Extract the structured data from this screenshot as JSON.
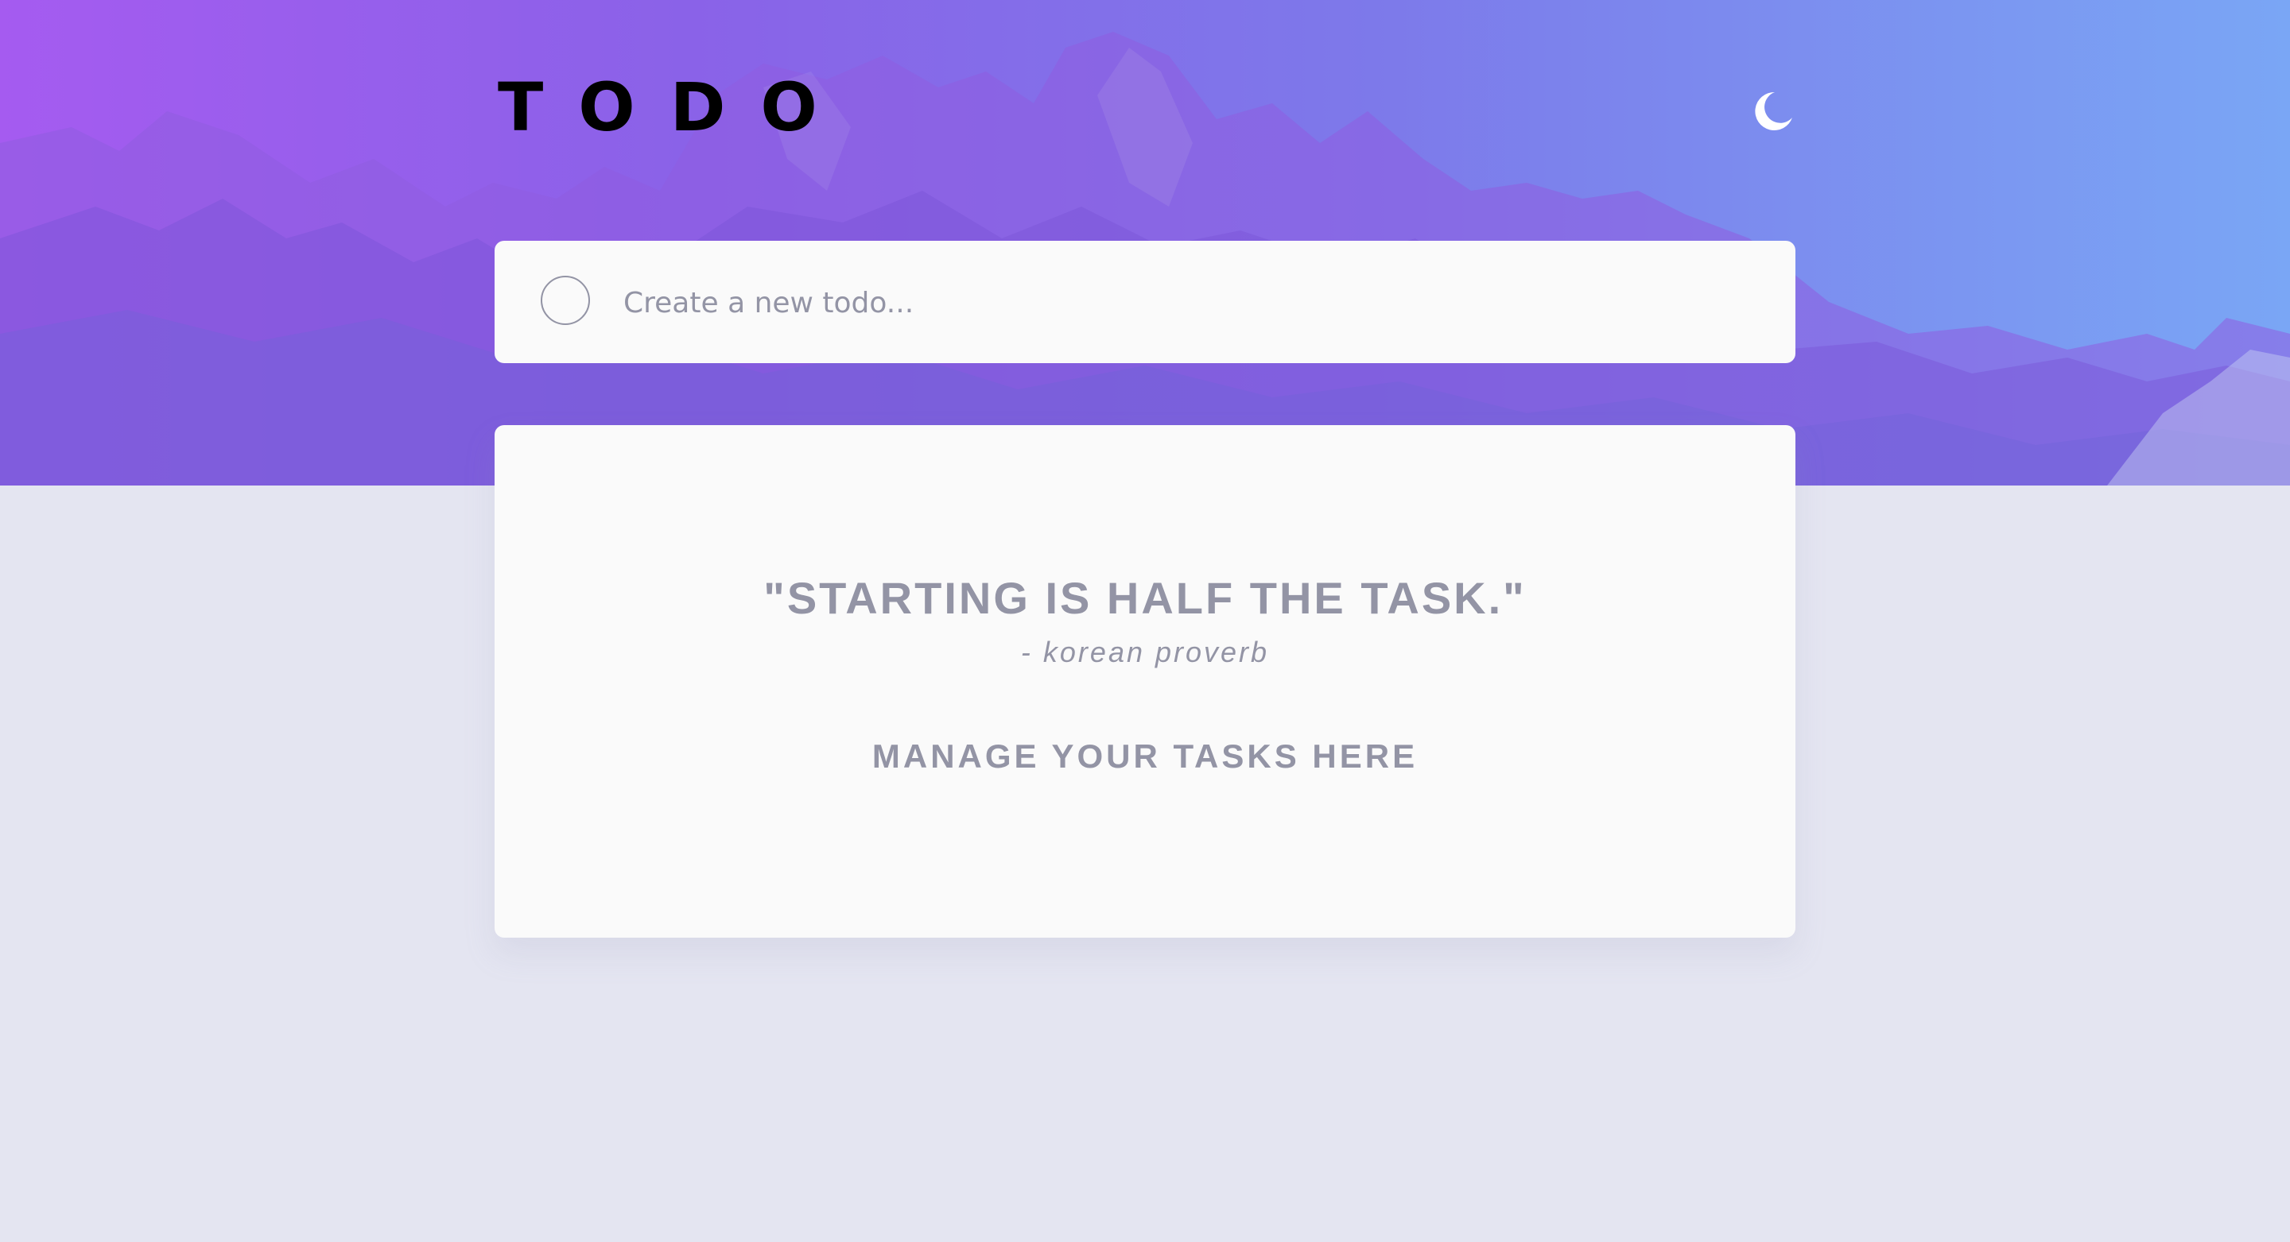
{
  "app": {
    "logo": "TODO"
  },
  "header": {
    "theme_icon": "moon-icon"
  },
  "new_todo": {
    "placeholder": "Create a new todo...",
    "value": ""
  },
  "empty_state": {
    "quote": "\"STARTING IS HALF THE TASK.\"",
    "author": "- korean proverb",
    "message": "MANAGE YOUR TASKS HERE"
  },
  "colors": {
    "background": "#e4e5f1",
    "card": "#fafafa",
    "muted_text": "#9394a5",
    "gradient_start": "#a55bf0",
    "gradient_end": "#7aa6f5"
  }
}
